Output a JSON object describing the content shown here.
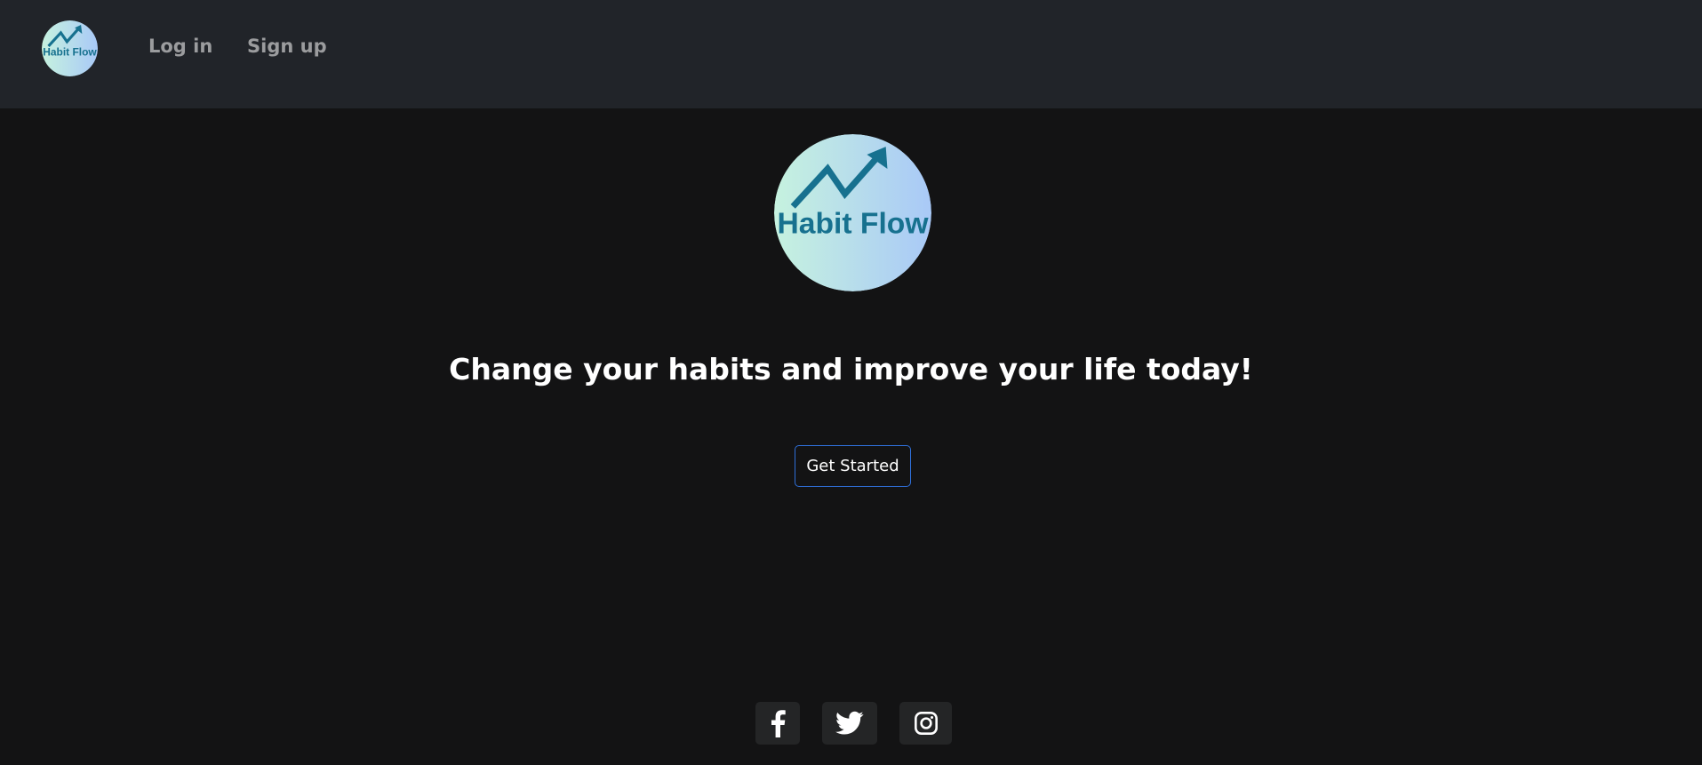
{
  "brand": {
    "logo_text": "Habit Flow",
    "gradient_start": "#c6f2df",
    "gradient_end": "#a9c9f7",
    "logo_ink": "#17718f"
  },
  "nav": {
    "login_label": "Log in",
    "signup_label": "Sign up"
  },
  "hero": {
    "headline": "Change your habits and improve your life today!",
    "cta_label": "Get Started"
  },
  "social": [
    {
      "icon": "facebook-icon"
    },
    {
      "icon": "twitter-icon"
    },
    {
      "icon": "instagram-icon"
    }
  ],
  "colors": {
    "page_bg": "#131314",
    "navbar_bg": "#212429",
    "nav_link": "#9b9c9e",
    "cta_border": "#2f6fd8",
    "social_bg": "#242526"
  }
}
